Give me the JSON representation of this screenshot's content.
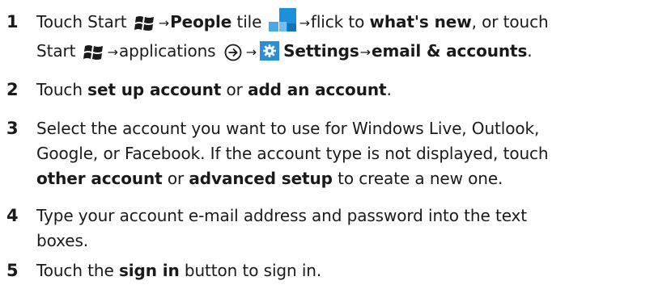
{
  "steps": [
    {
      "number": "1",
      "line1": {
        "t1": "Touch Start ",
        "arrow1": "→",
        "people": "People",
        "t2": " tile ",
        "arrow2": "→",
        "t3": "flick to ",
        "whatsnew": "what's new",
        "t4": ", or touch"
      },
      "line2": {
        "t1": "Start ",
        "arrow1": "→",
        "t2": "applications ",
        "arrow2": "→",
        "settings": "Settings",
        "arrow3": "→",
        "email": "email & accounts",
        "t3": "."
      }
    },
    {
      "number": "2",
      "t1": "Touch ",
      "b1": "set up account",
      "t2": " or ",
      "b2": "add an account",
      "t3": "."
    },
    {
      "number": "3",
      "line1": "Select the account you want to use for Windows Live, Outlook,",
      "line2": "Google, or Facebook. If the account type is not displayed, touch",
      "line3": {
        "b1": "other account",
        "t1": " or ",
        "b2": "advanced setup",
        "t2": " to create a new one."
      }
    },
    {
      "number": "4",
      "line1": "Type your account e-mail address and password into the text",
      "line2": "boxes."
    },
    {
      "number": "5",
      "t1": "Touch the ",
      "b1": "sign in",
      "t2": " button to sign in."
    }
  ],
  "icons": {
    "windows_logo": "windows-start-icon",
    "people_tile": "people-tile-icon",
    "applications": "applications-arrow-icon",
    "settings": "settings-gear-icon"
  },
  "colors": {
    "text": "#1a1a1a",
    "tile_blue": "#1e90d8",
    "settings_blue": "#2a8fd6"
  }
}
